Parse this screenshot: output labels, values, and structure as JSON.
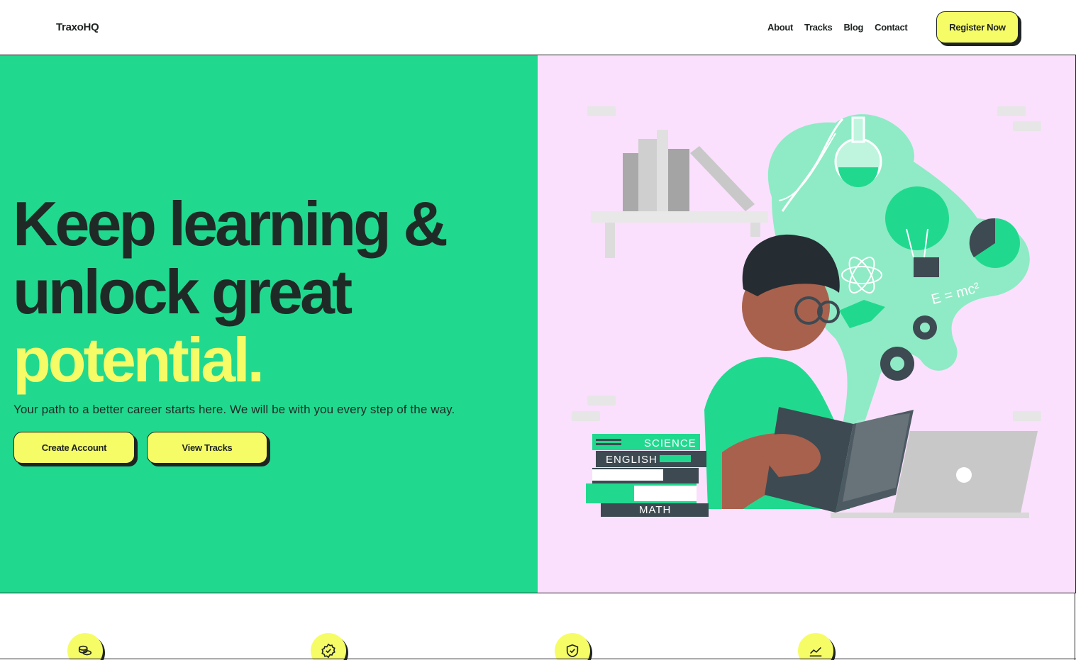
{
  "nav": {
    "logo": "TraxoHQ",
    "links": [
      "About",
      "Tracks",
      "Blog",
      "Contact"
    ],
    "register_label": "Register Now"
  },
  "hero": {
    "headline_line1": "Keep learning &",
    "headline_line2": "unlock great",
    "headline_accent": "potential.",
    "subtitle": "Your path to a better career starts here. We will be with you every step of the way.",
    "create_account_label": "Create Account",
    "view_tracks_label": "View Tracks"
  },
  "illustration": {
    "book_labels": [
      "SCIENCE",
      "ENGLISH",
      "MATH"
    ],
    "formula": "E = mc²"
  },
  "features": {
    "icons": [
      "coins-icon",
      "badge-check-icon",
      "shield-check-icon",
      "trending-up-icon"
    ]
  },
  "colors": {
    "green": "#20d98f",
    "yellow": "#f6fc66",
    "pink": "#fae0fc",
    "dark": "#1f2422"
  }
}
